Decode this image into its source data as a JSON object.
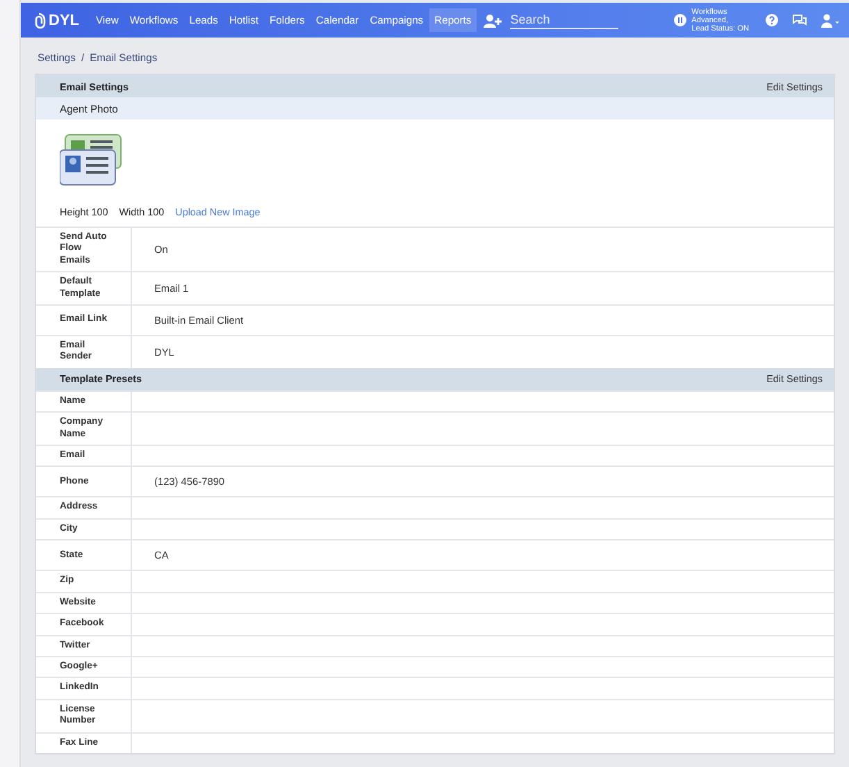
{
  "navbar": {
    "logo": "DYL",
    "items": [
      {
        "label": "View",
        "selected": false
      },
      {
        "label": "Workflows",
        "selected": false
      },
      {
        "label": "Leads",
        "selected": false
      },
      {
        "label": "Hotlist",
        "selected": false
      },
      {
        "label": "Folders",
        "selected": false
      },
      {
        "label": "Calendar",
        "selected": false
      },
      {
        "label": "Campaigns",
        "selected": false
      },
      {
        "label": "Reports",
        "selected": true
      }
    ],
    "search": {
      "placeholder": "Search"
    },
    "status": [
      "Workflows",
      "Advanced,",
      "Lead Status: ON"
    ]
  },
  "breadcrumb": [
    "Settings",
    "/",
    "Email Settings"
  ],
  "email_settings": {
    "title": "Email Settings",
    "action": "Edit Settings",
    "agent_photo": {
      "title": "Agent Photo",
      "height": "Height 100",
      "width": "Width 100",
      "upload": "Upload New Image"
    },
    "rows": [
      {
        "label": "Send Auto Flow Emails",
        "value": "On"
      },
      {
        "label": "Default Template",
        "value": "Email 1"
      },
      {
        "label": "Email Link",
        "value": "Built-in Email Client"
      },
      {
        "label": "Email Sender",
        "value": "DYL"
      }
    ]
  },
  "template_presets": {
    "title": "Template Presets",
    "action": "Edit Settings",
    "rows": [
      {
        "label": "Name"
      },
      {
        "label": "Company Name"
      },
      {
        "label": "Email"
      },
      {
        "label": "Phone",
        "value": "(123) 456-7890"
      },
      {
        "label": "Address"
      },
      {
        "label": "City"
      },
      {
        "label": "State",
        "value": "CA"
      },
      {
        "label": "Zip"
      },
      {
        "label": "Website"
      },
      {
        "label": "Facebook"
      },
      {
        "label": "Twitter"
      },
      {
        "label": "Google+"
      },
      {
        "label": "LinkedIn"
      },
      {
        "label": "License Number"
      },
      {
        "label": "Fax Line"
      }
    ]
  }
}
